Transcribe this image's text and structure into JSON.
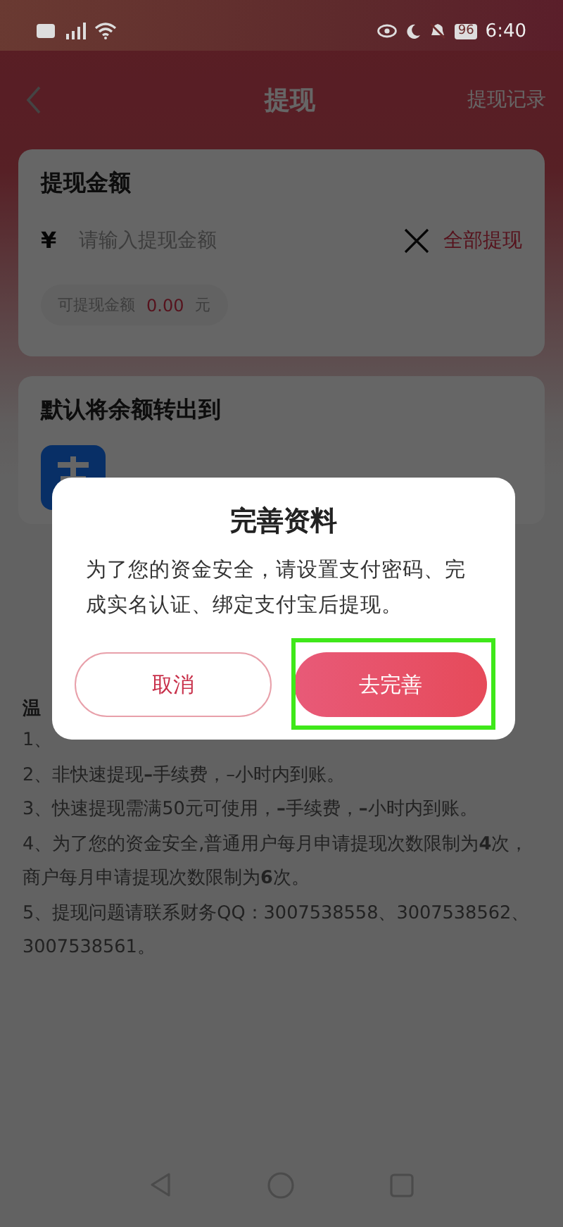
{
  "status_bar": {
    "time": "6:40",
    "battery": "96"
  },
  "header": {
    "title": "提现",
    "action": "提现记录"
  },
  "amount_card": {
    "title": "提现金额",
    "currency": "¥",
    "placeholder": "请输入提现金额",
    "withdraw_all": "全部提现",
    "available_label": "可提现金额",
    "available_value": "0.00",
    "available_unit": "元"
  },
  "account_card": {
    "title": "默认将余额转出到"
  },
  "tips": {
    "title": "温",
    "items": [
      "1、",
      "2、非快速提现**–**手续费，–小时内到账。",
      "3、快速提现需满50元可使用，**–**手续费，**–**小时内到账。",
      "4、为了您的资金安全,普通用户每月申请提现次数限制为**4**次，商户每月申请提现次数限制为**6**次。",
      "5、提现问题请联系财务QQ：3007538558、3007538562、3007538561。"
    ]
  },
  "dialog": {
    "title": "完善资料",
    "message": "为了您的资金安全，请设置支付密码、完成实名认证、绑定支付宝后提现。",
    "buttons": [
      {
        "label": "取消",
        "kind": "outline",
        "highlighted": false
      },
      {
        "label": "去完善",
        "kind": "filled",
        "highlighted": true
      }
    ]
  }
}
